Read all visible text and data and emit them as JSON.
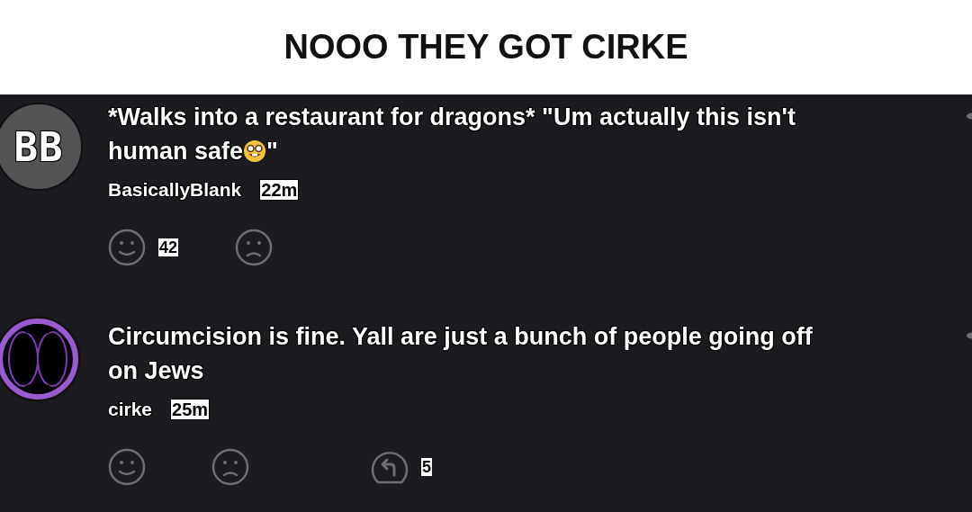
{
  "caption": "NOOO THEY GOT CIRKE",
  "comments": [
    {
      "avatar": {
        "kind": "initials",
        "text": "BB"
      },
      "text": "*Walks into a restaurant for dragons* \"Um actually this isn't\nhuman safe",
      "emoji": {
        "kind": "nerd"
      },
      "text_end": "\"",
      "username": "BasicallyBlank",
      "time": "22m",
      "likes": "42"
    },
    {
      "avatar": {
        "kind": "orb"
      },
      "text": "Circumcision is fine. Yall are just a bunch of people going off\non Jews",
      "username": "cirke",
      "time": "25m",
      "replies": "5"
    }
  ]
}
